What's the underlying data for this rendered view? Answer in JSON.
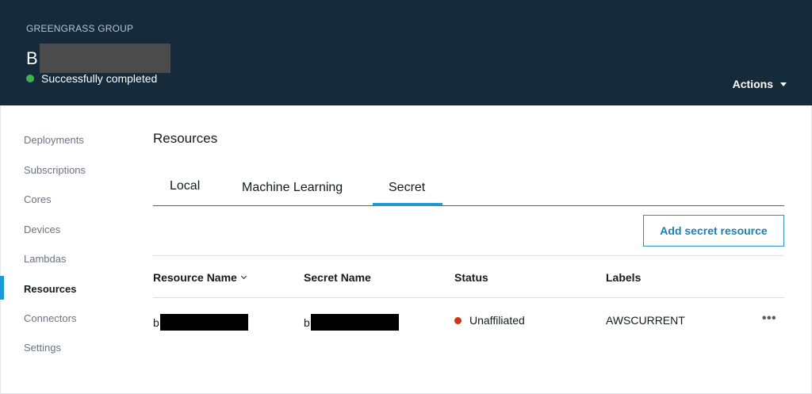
{
  "header": {
    "eyebrow": "GREENGRASS GROUP",
    "group_name_visible": "B",
    "status_text": "Successfully completed",
    "actions_label": "Actions"
  },
  "sidebar": {
    "items": [
      {
        "label": "Deployments",
        "active": false
      },
      {
        "label": "Subscriptions",
        "active": false
      },
      {
        "label": "Cores",
        "active": false
      },
      {
        "label": "Devices",
        "active": false
      },
      {
        "label": "Lambdas",
        "active": false
      },
      {
        "label": "Resources",
        "active": true
      },
      {
        "label": "Connectors",
        "active": false
      },
      {
        "label": "Settings",
        "active": false
      }
    ]
  },
  "main": {
    "title": "Resources",
    "tabs": [
      {
        "label": "Local",
        "active": false
      },
      {
        "label": "Machine Learning",
        "active": false
      },
      {
        "label": "Secret",
        "active": true
      }
    ],
    "add_button_label": "Add secret resource",
    "table": {
      "columns": [
        "Resource Name",
        "Secret Name",
        "Status",
        "Labels"
      ],
      "sorted_column": "Resource Name",
      "rows": [
        {
          "resource_name_visible": "b",
          "secret_name_visible": "b",
          "status": "Unaffiliated",
          "labels": "AWSCURRENT",
          "actions_glyph": "•••"
        }
      ]
    }
  },
  "colors": {
    "header_bg": "#152a3a",
    "accent": "#1c9ad6",
    "success": "#3fb34f",
    "error": "#d13212"
  },
  "icons": {
    "status_success": "status-success-icon",
    "status_error": "status-error-icon",
    "actions_caret": "caret-down-icon",
    "sort": "chevron-down-icon",
    "row_menu": "more-options-icon"
  }
}
